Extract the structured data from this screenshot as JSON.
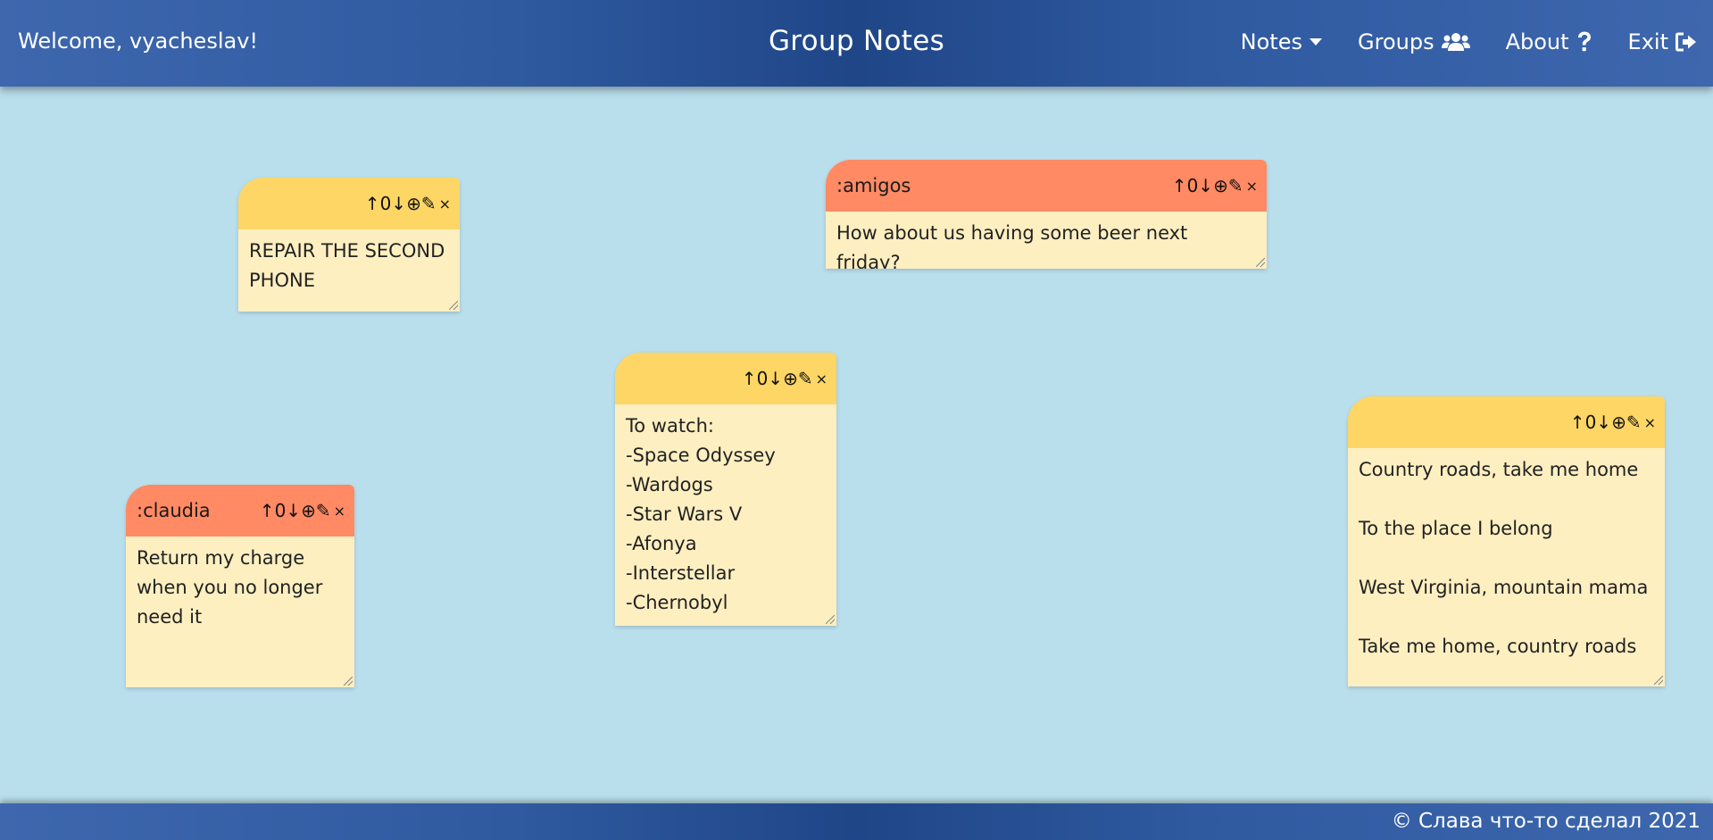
{
  "header": {
    "welcome": "Welcome, vyacheslav!",
    "title": "Group Notes",
    "nav": [
      {
        "label": "Notes",
        "icon": "caret-down-icon"
      },
      {
        "label": "Groups",
        "icon": "users-icon"
      },
      {
        "label": "About",
        "icon": "question-icon"
      },
      {
        "label": "Exit",
        "icon": "sign-out-icon"
      }
    ]
  },
  "colors": {
    "background": "#b9deec",
    "personal_note_header": "#fdd665",
    "group_note_header": "#ff8a64",
    "note_body": "#feefc1",
    "bar": "#2f5aa0"
  },
  "notes": [
    {
      "group": "",
      "score": "0",
      "text": "REPAIR THE SECOND PHONE"
    },
    {
      "group": ":amigos",
      "score": "0",
      "text": "How about us having some beer next friday?"
    },
    {
      "group": "",
      "score": "0",
      "text": "To watch:\n-Space Odyssey\n-Wardogs\n-Star Wars V\n-Afonya\n-Interstellar\n-Chernobyl"
    },
    {
      "group": "",
      "score": "0",
      "text": "Country roads, take me home\n\nTo the place I belong\n\nWest Virginia, mountain mama\n\nTake me home, country roads"
    },
    {
      "group": ":claudia",
      "score": "0",
      "text": "Return my charge when you no longer need it"
    }
  ],
  "controls": {
    "up": "↑",
    "down": "↓",
    "add": "⊕",
    "edit": "✎",
    "close": "×"
  },
  "footer": {
    "text": "© Слава что-то сделал 2021"
  }
}
